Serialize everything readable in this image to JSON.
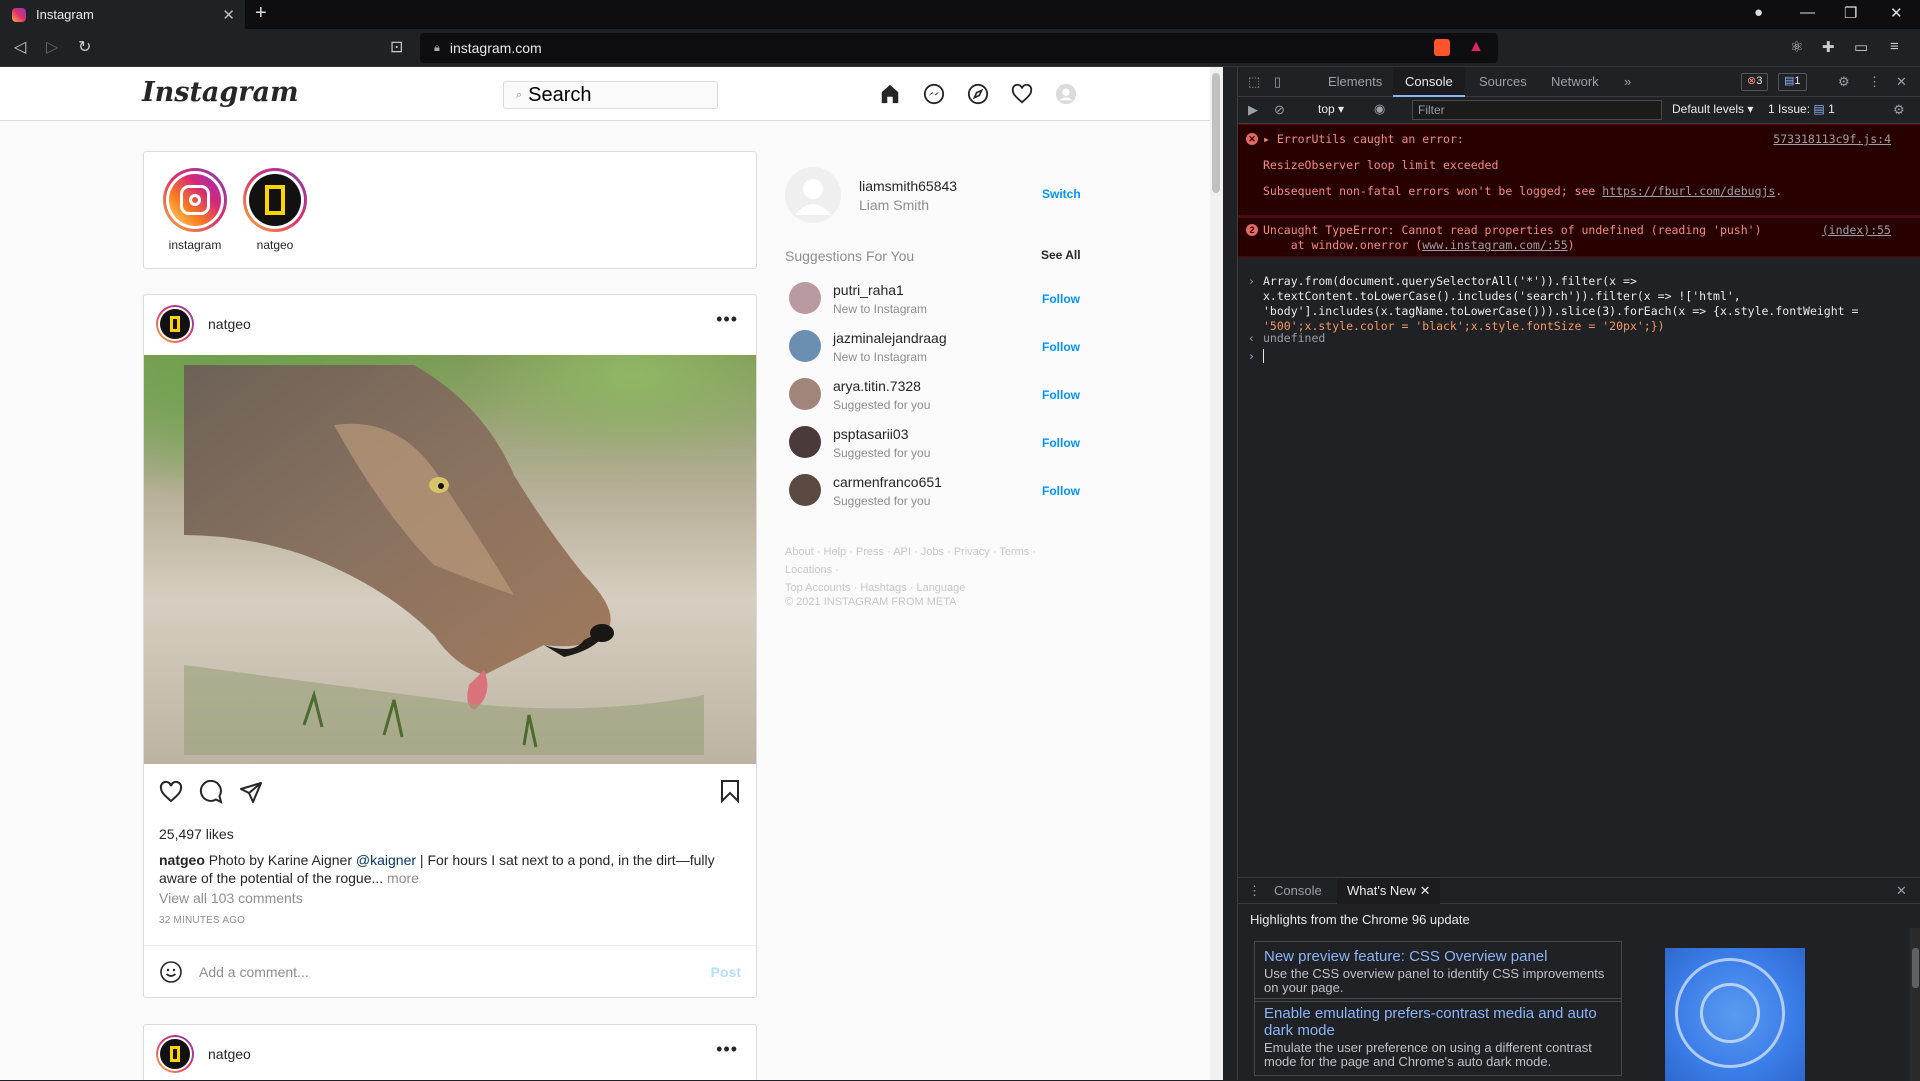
{
  "browser": {
    "tab_title": "Instagram",
    "url": "instagram.com"
  },
  "ig": {
    "logo": "Instagram",
    "search_text": "Search",
    "stories": [
      {
        "label": "instagram"
      },
      {
        "label": "natgeo"
      }
    ],
    "posts": [
      {
        "user": "natgeo",
        "likes": "25,497 likes",
        "caption_user": "natgeo",
        "caption_text_1": " Photo by Karine Aigner ",
        "caption_mention": "@kaigner",
        "caption_text_2": " | For hours I sat next to a pond, in the dirt—fully aware of the potential of the rogue...",
        "caption_more": " more",
        "view_comments": "View all 103 comments",
        "time_ago": "32 MINUTES AGO",
        "comment_placeholder": "Add a comment...",
        "post_label": "Post"
      },
      {
        "user": "natgeo"
      }
    ],
    "sidebar": {
      "username": "liamsmith65843",
      "fullname": "Liam Smith",
      "switch": "Switch",
      "suggestions_title": "Suggestions For You",
      "see_all": "See All",
      "suggestions": [
        {
          "user": "putri_raha1",
          "sub": "New to Instagram",
          "follow": "Follow",
          "color": "#b89aa0"
        },
        {
          "user": "jazminalejandraag",
          "sub": "New to Instagram",
          "follow": "Follow",
          "color": "#6b8fb0"
        },
        {
          "user": "arya.titin.7328",
          "sub": "Suggested for you",
          "follow": "Follow",
          "color": "#a2857a"
        },
        {
          "user": "psptasarii03",
          "sub": "Suggested for you",
          "follow": "Follow",
          "color": "#4a3a3a"
        },
        {
          "user": "carmenfranco651",
          "sub": "Suggested for you",
          "follow": "Follow",
          "color": "#5a4a42"
        }
      ],
      "footer_1": "About · Help · Press · API · Jobs · Privacy · Terms · Locations ·",
      "footer_2": "Top Accounts · Hashtags · Language",
      "copyright": "© 2021 INSTAGRAM FROM META"
    }
  },
  "devtools": {
    "tabs": [
      "Elements",
      "Console",
      "Sources",
      "Network"
    ],
    "active_tab": "Console",
    "error_count": "3",
    "issue_count": "1",
    "context": "top",
    "filter_placeholder": "Filter",
    "levels": "Default levels",
    "issues_label": "1 Issue:",
    "issues_num": "1",
    "err1_line1": "ErrorUtils caught an error:",
    "err1_line2": "ResizeObserver loop limit exceeded",
    "err1_line3": "Subsequent non-fatal errors won't be logged; see ",
    "err1_link": "https://fburl.com/debugjs",
    "err1_dot": ".",
    "err1_src": "573318113c9f.js:4",
    "err2_count": "2",
    "err2_line1": "Uncaught TypeError: Cannot read properties of undefined (reading 'push')",
    "err2_line2": "    at window.onerror (",
    "err2_link": "www.instagram.com/:55",
    "err2_close": ")",
    "err2_src": "(index):55",
    "cmd_line1": "Array.from(document.querySelectorAll('*')).filter(x =>",
    "cmd_line2": "x.textContent.toLowerCase().includes('search')).filter(x => !['html',",
    "cmd_line3": "'body'].includes(x.tagName.toLowerCase())).slice(3).forEach(x => {x.style.fontWeight =",
    "cmd_line4": "'500';x.style.color = 'black';x.style.fontSize = '20px';})",
    "result": "undefined",
    "drawer_tabs": [
      "Console",
      "What's New"
    ],
    "whats_new_title": "Highlights from the Chrome 96 update",
    "cards": [
      {
        "title": "New preview feature: CSS Overview panel",
        "desc": "Use the CSS overview panel to identify CSS improvements on your page."
      },
      {
        "title": "Enable emulating prefers-contrast media and auto dark mode",
        "desc": "Emulate the user preference on using a different contrast mode for the page and Chrome's auto dark mode."
      }
    ]
  }
}
